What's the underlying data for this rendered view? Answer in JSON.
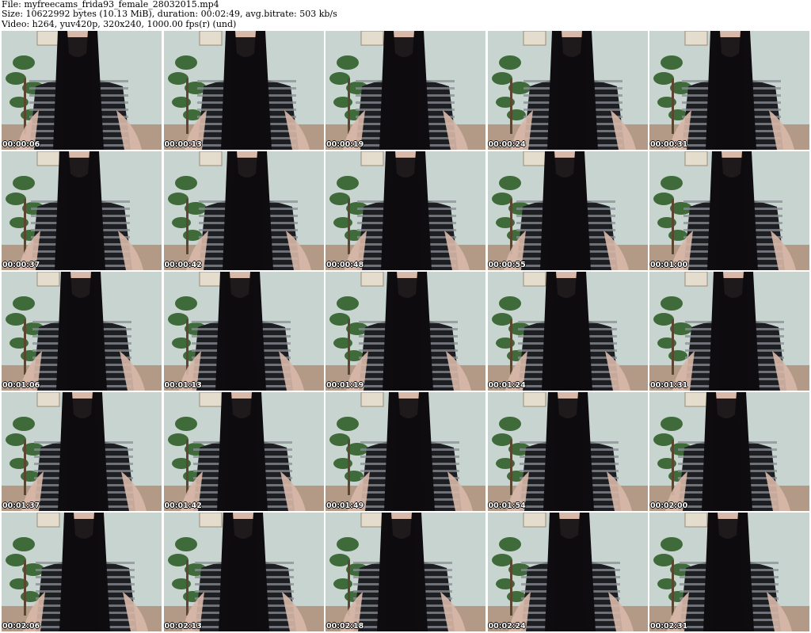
{
  "header": {
    "file_line": "File: myfreecams_frida93_female_28032015.mp4",
    "size_line": "Size: 10622992 bytes (10.13 MiB), duration: 00:02:49, avg.bitrate: 503 kb/s",
    "video_line": "Video: h264, yuv420p, 320x240, 1000.00 fps(r) (und)"
  },
  "colors": {
    "wall": "#c8d4d0",
    "floor": "#a06a4a",
    "plant": "#3f6b3a",
    "hair": "#0e0c0f",
    "shirt_dark": "#1c1e22",
    "shirt_stripe": "#8a8e94",
    "skin": "#d8b8a8"
  },
  "thumbnails": [
    {
      "timestamp": "00:00:06"
    },
    {
      "timestamp": "00:00:13"
    },
    {
      "timestamp": "00:00:19"
    },
    {
      "timestamp": "00:00:24"
    },
    {
      "timestamp": "00:00:31"
    },
    {
      "timestamp": "00:00:37"
    },
    {
      "timestamp": "00:00:42"
    },
    {
      "timestamp": "00:00:48"
    },
    {
      "timestamp": "00:00:55"
    },
    {
      "timestamp": "00:01:00"
    },
    {
      "timestamp": "00:01:06"
    },
    {
      "timestamp": "00:01:13"
    },
    {
      "timestamp": "00:01:19"
    },
    {
      "timestamp": "00:01:24"
    },
    {
      "timestamp": "00:01:31"
    },
    {
      "timestamp": "00:01:37"
    },
    {
      "timestamp": "00:01:42"
    },
    {
      "timestamp": "00:01:49"
    },
    {
      "timestamp": "00:01:54"
    },
    {
      "timestamp": "00:02:00"
    },
    {
      "timestamp": "00:02:06"
    },
    {
      "timestamp": "00:02:13"
    },
    {
      "timestamp": "00:02:18"
    },
    {
      "timestamp": "00:02:24"
    },
    {
      "timestamp": "00:02:31"
    }
  ]
}
